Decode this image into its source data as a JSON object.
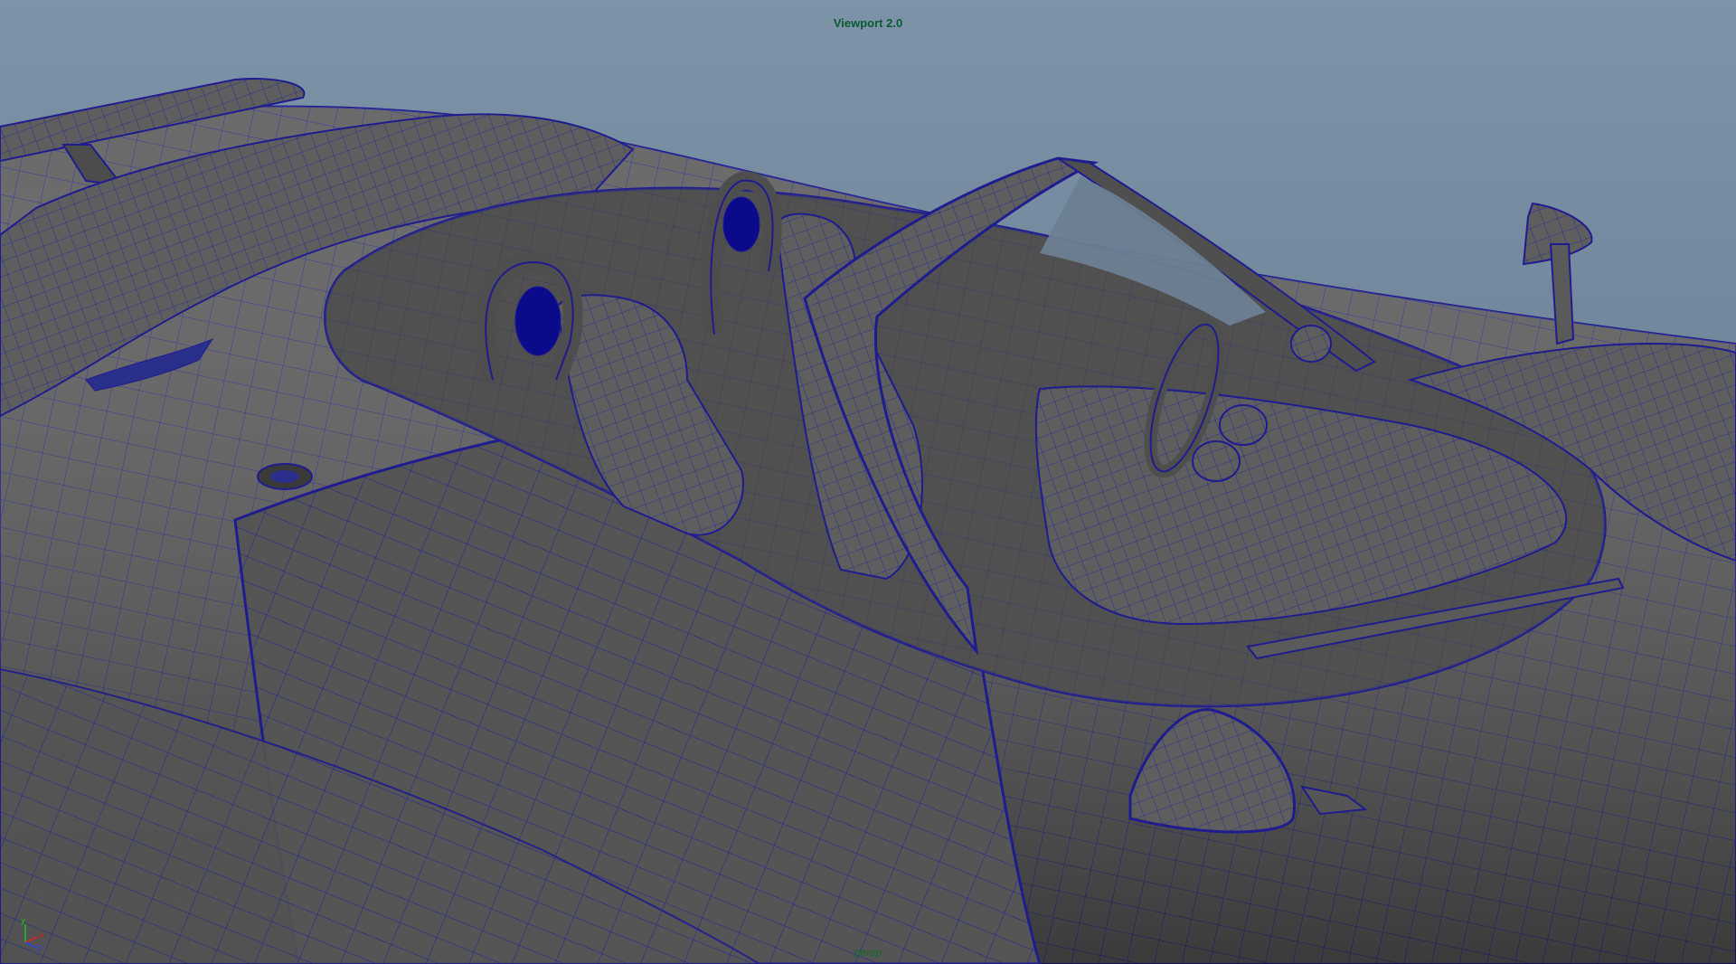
{
  "viewport": {
    "title": "Viewport 2.0",
    "camera": "persp",
    "colors": {
      "background_top": "#7d93a8",
      "background_bottom": "#2a2f36",
      "mesh_fill": "#5a5a5a",
      "wireframe": "#1f1c8f",
      "title_text": "#0c5a33",
      "camera_text": "#0b6b2c"
    }
  },
  "axis_gizmo": {
    "x_label": "x",
    "y_label": "y",
    "z_label": "z",
    "x_color": "#e02020",
    "y_color": "#20c020",
    "z_color": "#2040ff"
  },
  "model": {
    "icon": "car-wireframe-model"
  }
}
